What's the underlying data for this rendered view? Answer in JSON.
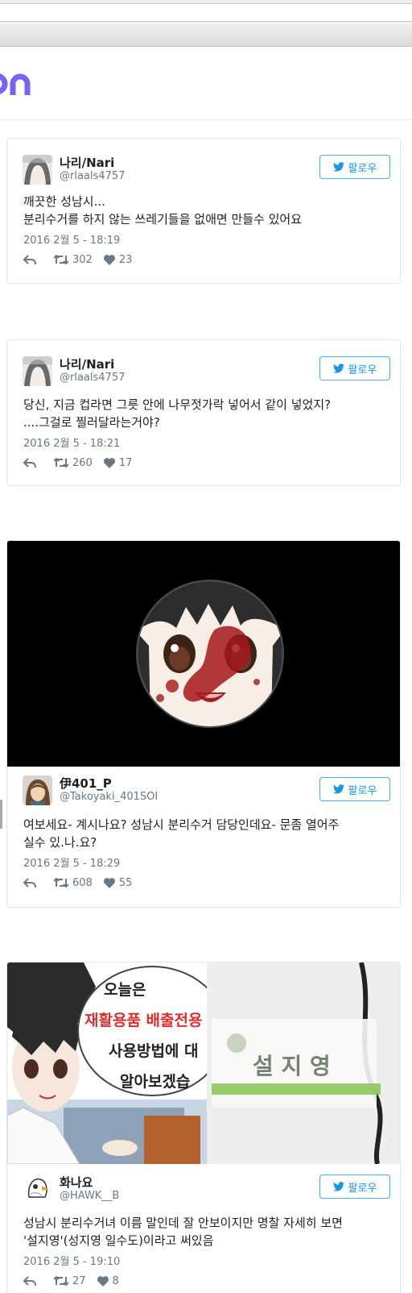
{
  "follow_label": "팔로우",
  "colors": {
    "twitter_blue": "#1b95e0",
    "text": "#1c2022",
    "meta": "#697882",
    "border": "#e1e8ed",
    "logo_purple": "#7b62f2"
  },
  "icons": {
    "bird": "twitter-bird-icon",
    "reply": "reply-icon",
    "retweet": "retweet-icon",
    "like": "heart-icon"
  },
  "tweets": [
    {
      "name": "나리/Nari",
      "handle": "@rlaals4757",
      "text": "깨끗한 성남시...\n분리수거를 하지 않는 쓰레기들을 없애면 만들수 있어요",
      "date": "2016 2월 5 - 18:19",
      "retweets": "302",
      "likes": "23"
    },
    {
      "name": "나리/Nari",
      "handle": "@rlaals4757",
      "text": "당신, 지금 컵라면 그릇 안에 나무젓가락 넣어서 같이 넣었지?\n....그걸로 찔러달라는거야?",
      "date": "2016 2월 5 - 18:21",
      "retweets": "260",
      "likes": "17"
    },
    {
      "name": "伊401_P",
      "handle": "@Takoyaki_401SOI",
      "text": "여보세요- 계시나요? 성남시 분리수거 담당인데요- 문좀 열어주\n실수 있.나.요?",
      "date": "2016 2월 5 - 18:29",
      "retweets": "608",
      "likes": "55"
    },
    {
      "name": "화나요",
      "handle": "@HAWK__B",
      "text": "성남시 분리수거녀 이름 말인데 잘 안보이지만 명찰 자세히 보면\n'설지영'(성지영 일수도)이라고 써있음",
      "date": "2016 2월 5 - 19:10",
      "retweets": "27",
      "likes": "8"
    }
  ],
  "comic": {
    "lines": [
      "오늘은",
      "재활용품 배출전용",
      "사용방법에 대",
      "알아보겠습"
    ],
    "name_tag": "설 지 영"
  }
}
